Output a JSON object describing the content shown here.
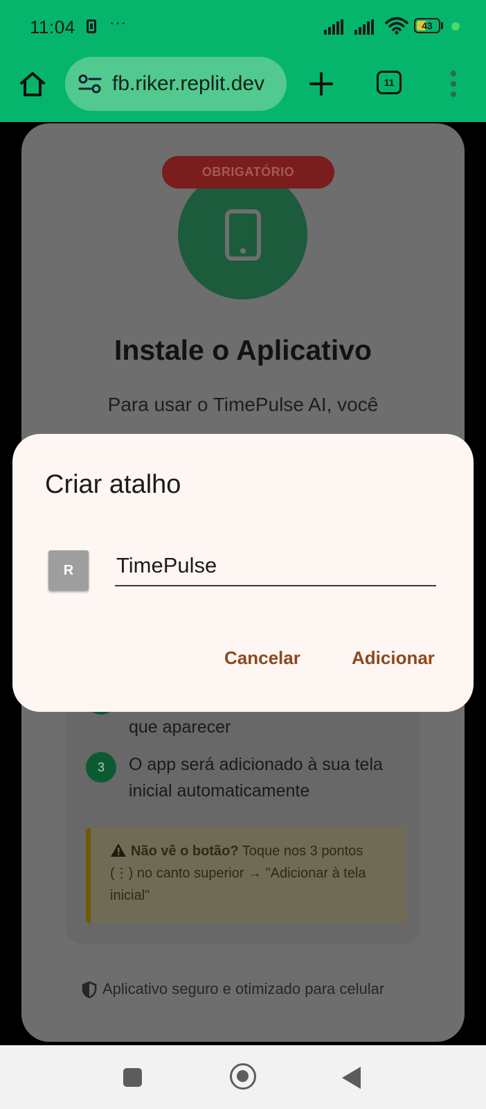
{
  "status_bar": {
    "time": "11:04",
    "more": "···",
    "battery": "43"
  },
  "browser": {
    "url": "fb.riker.replit.dev",
    "tab_count": "11"
  },
  "page": {
    "badge": "OBRIGATÓRIO",
    "title": "Instale o Aplicativo",
    "description_line1": "Para usar o TimePulse AI, você",
    "steps": [
      {
        "number": "",
        "text": "que aparecer"
      },
      {
        "number": "3",
        "text_line1": "O app será adicionado à sua tela",
        "text_line2": "inicial automaticamente"
      }
    ],
    "warning": {
      "title": "Não vê o botão?",
      "text": "Toque nos 3 pontos (⋮) no canto superior → \"Adicionar à tela inicial\""
    },
    "footer": "Aplicativo seguro e otimizado para celular"
  },
  "dialog": {
    "title": "Criar atalho",
    "icon_letter": "R",
    "name_value": "TimePulse",
    "cancel_label": "Cancelar",
    "add_label": "Adicionar"
  },
  "colors": {
    "header_green": "#05b56c",
    "dialog_bg": "#fdf6f3",
    "dialog_button": "#8b4a1c"
  }
}
